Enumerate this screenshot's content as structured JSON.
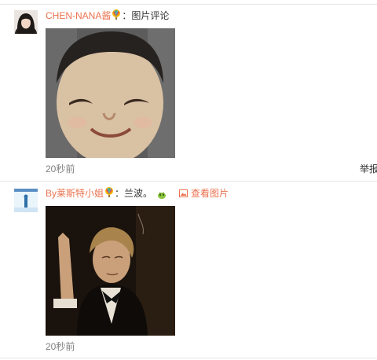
{
  "comments": [
    {
      "username": "CHEN-NANA酱",
      "separator": "：",
      "text": "图片评论",
      "time": "20秒前",
      "report_label": "举报"
    },
    {
      "username": "By莱斯特小姐",
      "separator": "：",
      "text": "兰波。",
      "view_image_label": "查看图片",
      "time": "20秒前"
    }
  ],
  "colors": {
    "username": "#eb7350",
    "timestamp": "#808080",
    "divider": "#e6e6e6"
  },
  "icons": [
    "member-badge-icon",
    "picture-icon",
    "emoji-icon"
  ]
}
